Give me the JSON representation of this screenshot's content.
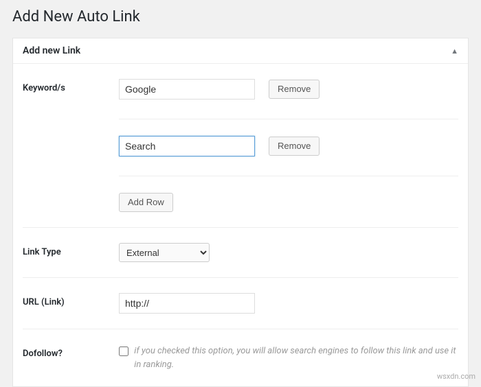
{
  "page": {
    "title": "Add New Auto Link"
  },
  "panel": {
    "header": "Add new Link"
  },
  "fields": {
    "keywords": {
      "label": "Keyword/s",
      "items": [
        {
          "value": "Google"
        },
        {
          "value": "Search"
        }
      ],
      "remove_label": "Remove",
      "add_row_label": "Add Row"
    },
    "link_type": {
      "label": "Link Type",
      "selected": "External"
    },
    "url": {
      "label": "URL (Link)",
      "value": "http://"
    },
    "dofollow": {
      "label": "Dofollow?",
      "help": "if you checked this option, you will allow search engines to follow this link and use it in ranking."
    }
  },
  "watermark": "wsxdn.com"
}
